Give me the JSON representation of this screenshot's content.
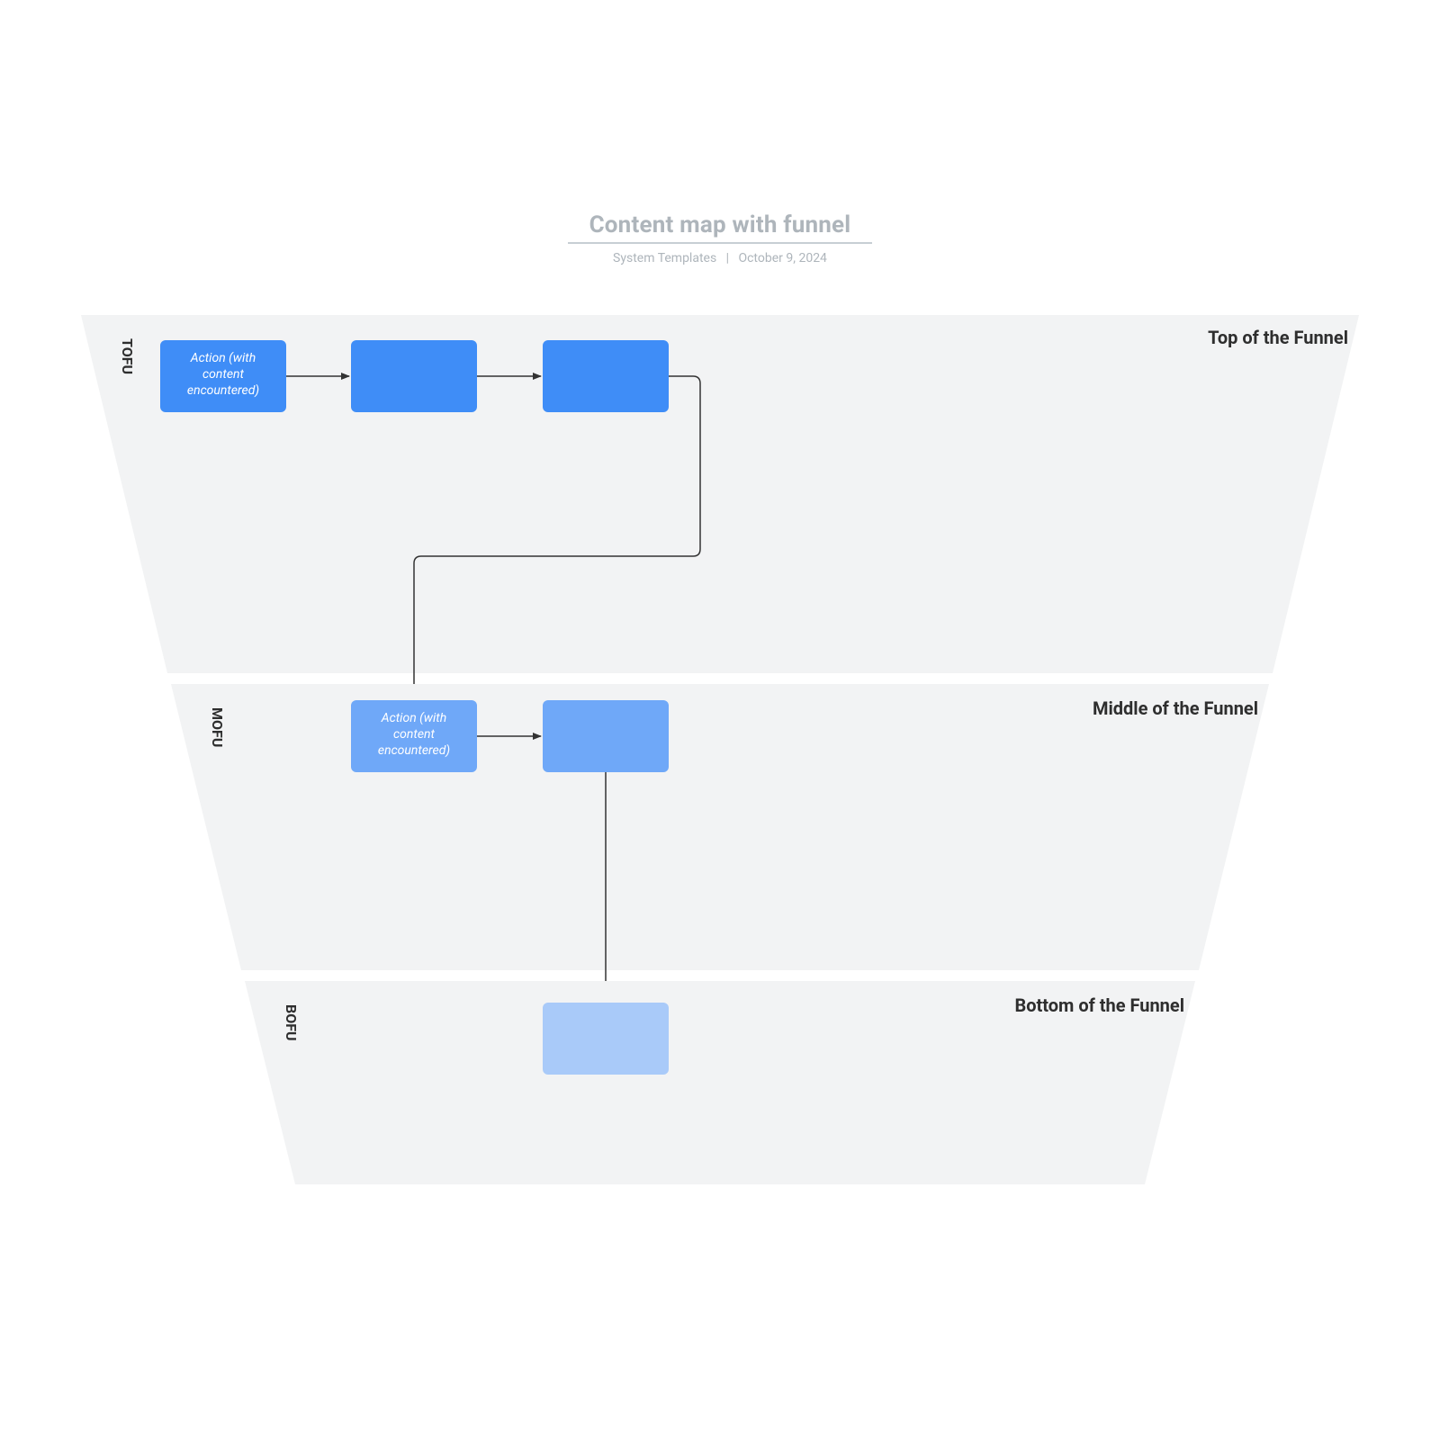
{
  "header": {
    "title": "Content map with funnel",
    "author": "System Templates",
    "date": "October 9, 2024"
  },
  "stages": {
    "tofu": {
      "abbr": "TOFU",
      "heading": "Top of the Funnel"
    },
    "mofu": {
      "abbr": "MOFU",
      "heading": "Middle of the Funnel"
    },
    "bofu": {
      "abbr": "BOFU",
      "heading": "Bottom of the Funnel"
    }
  },
  "boxes": {
    "tofu1": {
      "line1": "Action (with",
      "line2": "content",
      "line3": "encountered)"
    },
    "mofu1": {
      "line1": "Action (with",
      "line2": "content",
      "line3": "encountered)"
    }
  },
  "colors": {
    "stage_bg": "#f2f3f4",
    "tofu_box": "#3f8df7",
    "mofu_box": "#6fa8f8",
    "bofu_box": "#a9caf9",
    "arrow": "#333333"
  }
}
